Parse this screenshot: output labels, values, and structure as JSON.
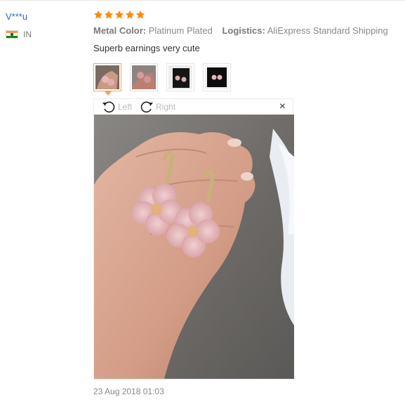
{
  "buyer": {
    "name": "V***u",
    "country": "IN",
    "flag_icon": "india-flag-icon"
  },
  "review": {
    "rating": 5,
    "star_color": "#ff8a00",
    "properties": [
      {
        "label": "Metal Color:",
        "value": "Platinum Plated"
      },
      {
        "label": "Logistics:",
        "value": "AliExpress Standard Shipping"
      }
    ],
    "comment": "Superb earnings very cute",
    "date": "23 Aug 2018 01:03"
  },
  "thumbnails": [
    "thumbnail-1",
    "thumbnail-2",
    "thumbnail-3",
    "thumbnail-4"
  ],
  "viewer": {
    "rotate_left_label": "Left",
    "rotate_right_label": "Right",
    "close_label": "×"
  },
  "colors": {
    "link": "#2a69c4",
    "accent": "#f2a361"
  }
}
